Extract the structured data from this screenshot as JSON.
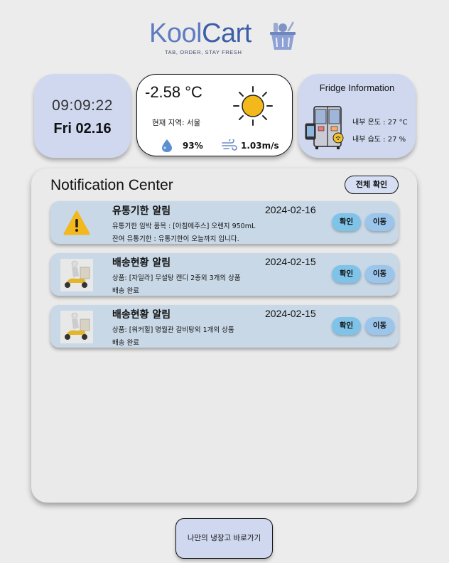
{
  "header": {
    "logo_part1": "Kool",
    "logo_part2": "Cart",
    "tagline": "TAB, ORDER, STAY FRESH",
    "logo_icon": "grocery-basket-icon"
  },
  "clock": {
    "time": "09:09:22",
    "date": "Fri 02.16"
  },
  "weather": {
    "temperature": "-2.58 °C",
    "region": "현재 지역: 서울",
    "condition_icon": "sun-icon",
    "humidity": "93%",
    "wind": "1.03m/s"
  },
  "fridge": {
    "title": "Fridge Information",
    "temperature": "내부 온도 : 27 °C",
    "humidity": "내부 습도 : 27 %",
    "icon": "smart-fridge-icon"
  },
  "notifications": {
    "title": "Notification Center",
    "confirm_all_label": "전체 확인",
    "items": [
      {
        "icon": "warning-icon",
        "title": "유통기한 알림",
        "date": "2024-02-16",
        "line1": "유통기한 임박 품목 : [아침에주스] 오렌지 950mL",
        "line2": "잔여 유통기한 : 유통기한이 오늘까지 입니다.",
        "confirm_label": "확인",
        "move_label": "이동"
      },
      {
        "icon": "delivery-scooter-icon",
        "title": "배송현황 알림",
        "date": "2024-02-15",
        "line1": "상품: [자일라] 무설탕 캔디 2종외 3개의 상품",
        "line2": "배송 완료",
        "confirm_label": "확인",
        "move_label": "이동"
      },
      {
        "icon": "delivery-scooter-icon",
        "title": "배송현황 알림",
        "date": "2024-02-15",
        "line1": "상품: [워커힐] 명월관 갈비탕외 1개의 상품",
        "line2": "배송 완료",
        "confirm_label": "확인",
        "move_label": "이동"
      }
    ]
  },
  "footer": {
    "my_fridge_label": "나만의 냉장고 바로가기"
  },
  "colors": {
    "card_blue": "#cfd8ef",
    "notif_item": "#c8d8e6",
    "confirm_btn": "#7fc4e8",
    "move_btn": "#9cc5ec",
    "logo_blue": "#5f7cc1"
  }
}
